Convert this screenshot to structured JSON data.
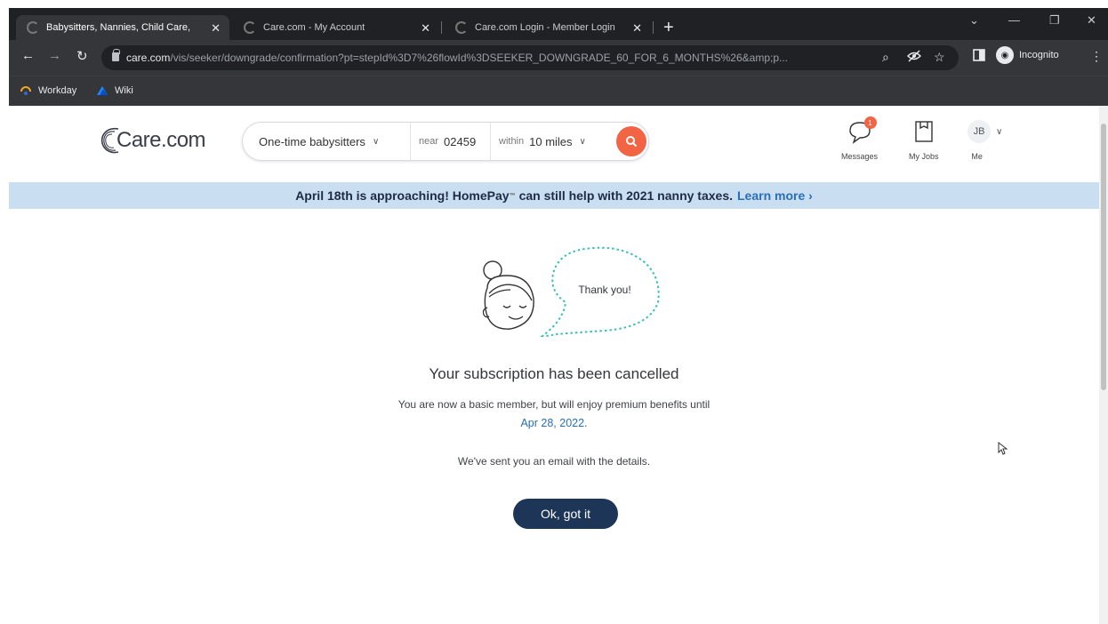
{
  "browser": {
    "tabs": [
      {
        "label": "Babysitters, Nannies, Child Care,",
        "active": true
      },
      {
        "label": "Care.com - My Account",
        "active": false
      },
      {
        "label": "Care.com Login - Member Login",
        "active": false
      }
    ],
    "url_host": "care.com",
    "url_path": "/vis/seeker/downgrade/confirmation?pt=stepId%3D7%26flowId%3DSEEKER_DOWNGRADE_60_FOR_6_MONTHS%26&amp;p...",
    "profile_label": "Incognito",
    "bookmarks": [
      {
        "label": "Workday"
      },
      {
        "label": "Wiki"
      }
    ]
  },
  "header": {
    "logo": "Care.com",
    "search": {
      "service": "One-time babysitters",
      "near_label": "near",
      "zip": "02459",
      "within_label": "within",
      "distance": "10 miles"
    },
    "nav": {
      "messages_label": "Messages",
      "messages_count": "1",
      "jobs_label": "My Jobs",
      "me_label": "Me",
      "initials": "JB"
    }
  },
  "banner": {
    "text_before": "April 18th is approaching! HomePay",
    "tm": "™",
    "text_after": "can still help with 2021 nanny taxes.",
    "link": "Learn more ›"
  },
  "confirmation": {
    "bubble_text": "Thank you!",
    "title": "Your subscription has been cancelled",
    "line1": "You are now a basic member, but will enjoy premium benefits until",
    "date": "Apr 28, 2022.",
    "line3": "We've sent you an email with the details.",
    "button_label": "Ok, got it"
  },
  "colors": {
    "accent_orange": "#f26443",
    "navy_button": "#1d3557",
    "banner_bg": "#c9dff1",
    "link_blue": "#2a6eb6",
    "teal_dots": "#3cbfb8"
  }
}
